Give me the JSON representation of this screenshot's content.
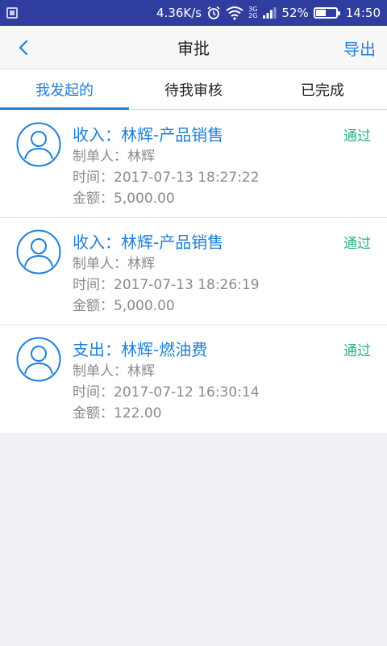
{
  "statusbar": {
    "speed": "4.36K/s",
    "network_top": "3G",
    "network_bottom": "2G",
    "battery": "52%",
    "battery_level": 0.52,
    "time": "14:50",
    "icons": [
      "app-notification-icon",
      "alarm-icon",
      "wifi-icon",
      "signal-icon",
      "battery-icon"
    ]
  },
  "navbar": {
    "title": "审批",
    "export_label": "导出",
    "back_icon": "chevron-left-icon"
  },
  "tabs": [
    {
      "label": "我发起的",
      "active": true
    },
    {
      "label": "待我审核",
      "active": false
    },
    {
      "label": "已完成",
      "active": false
    }
  ],
  "records": [
    {
      "title": "收入：林辉-产品销售",
      "status": "通过",
      "maker": "制单人：林辉",
      "time": "时间：2017-07-13 18:27:22",
      "amount": "金额：5,000.00"
    },
    {
      "title": "收入：林辉-产品销售",
      "status": "通过",
      "maker": "制单人：林辉",
      "time": "时间：2017-07-13 18:26:19",
      "amount": "金额：5,000.00"
    },
    {
      "title": "支出：林辉-燃油费",
      "status": "通过",
      "maker": "制单人：林辉",
      "time": "时间：2017-07-12 16:30:14",
      "amount": "金额：122.00"
    }
  ],
  "colors": {
    "statusbar": "#2f3e9e",
    "accent": "#1f7fd8",
    "approved": "#29b37a",
    "secondary_text": "#8a8a8a"
  }
}
